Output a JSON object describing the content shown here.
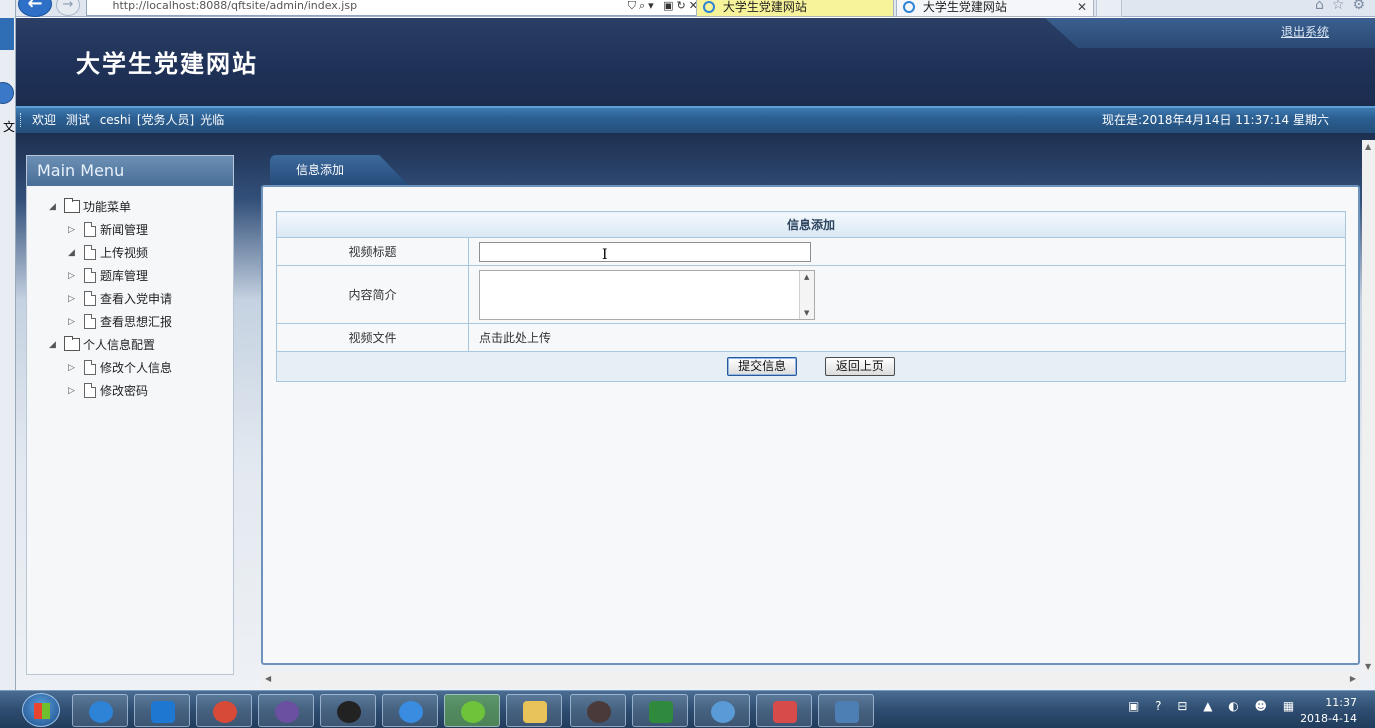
{
  "browser": {
    "url": "http://localhost:8088/qftsite/admin/index.jsp",
    "tabs": [
      "大学生党建网站",
      "大学生党建网站"
    ]
  },
  "header": {
    "site_title": "大学生党建网站",
    "logout_label": "退出系统"
  },
  "welcome": {
    "greeting": "欢迎",
    "name": "测试",
    "user": "ceshi",
    "role": "[党务人员]",
    "suffix": "光临",
    "time_text": "现在是:2018年4月14日  11:37:14 星期六"
  },
  "sidebar": {
    "title": "Main Menu",
    "groups": [
      {
        "label": "功能菜单",
        "items": [
          "新闻管理",
          "上传视频",
          "题库管理",
          "查看入党申请",
          "查看思想汇报"
        ]
      },
      {
        "label": "个人信息配置",
        "items": [
          "修改个人信息",
          "修改密码"
        ]
      }
    ]
  },
  "main": {
    "tab_label": "信息添加",
    "form": {
      "header": "信息添加",
      "title_label": "视频标题",
      "title_value": "",
      "intro_label": "内容简介",
      "intro_value": "",
      "file_label": "视频文件",
      "file_link": "点击此处上传",
      "submit_label": "提交信息",
      "back_label": "返回上页"
    }
  },
  "taskbar": {
    "clock_time": "11:37",
    "clock_date": "2018-4-14"
  },
  "colors": {
    "header_bg": "#1f3157",
    "welcome_bar": "#2b5f92",
    "panel_border": "#6d93bd",
    "table_border": "#a9c6df"
  }
}
